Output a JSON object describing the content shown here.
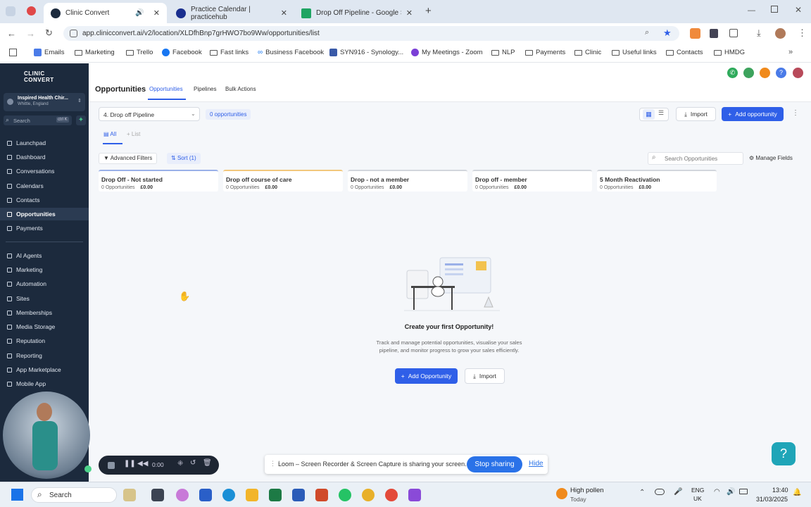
{
  "browser": {
    "tabs": [
      {
        "title": "Clinic Convert",
        "active": true
      },
      {
        "title": "Practice Calendar | practicehub",
        "active": false
      },
      {
        "title": "Drop Off Pipeline - Google She",
        "active": false
      }
    ],
    "new_tab": "+",
    "url": "app.clinicconvert.ai/v2/location/XLDfhBnp7grHWO7bo9Ww/opportunities/list",
    "bookmarks": [
      "Emails",
      "Marketing",
      "Trello",
      "Facebook",
      "Fast links",
      "Business Facebook",
      "SYN916 - Synology...",
      "My Meetings - Zoom",
      "NLP",
      "Payments",
      "Clinic",
      "Useful links",
      "Contacts",
      "HMDG"
    ]
  },
  "sidebar": {
    "logo": "CLINIC CONVERT",
    "account_name": "Inspired Health Chir...",
    "account_location": "Whittle, England",
    "search_placeholder": "Search",
    "search_shortcut": "ctrl K",
    "items": [
      "Launchpad",
      "Dashboard",
      "Conversations",
      "Calendars",
      "Contacts",
      "Opportunities",
      "Payments"
    ],
    "items2": [
      "AI Agents",
      "Marketing",
      "Automation",
      "Sites",
      "Memberships",
      "Media Storage",
      "Reputation",
      "Reporting",
      "App Marketplace",
      "Mobile App"
    ],
    "active": "Opportunities"
  },
  "header": {
    "title": "Opportunities",
    "tabs": [
      "Opportunities",
      "Pipelines",
      "Bulk Actions"
    ]
  },
  "toolbar": {
    "pipeline": "4. Drop off Pipeline",
    "count": "0 opportunities",
    "import": "Import",
    "add": "Add opportunity",
    "view_all": "All",
    "view_list": "List",
    "filters": "Advanced Filters",
    "sort": "Sort (1)",
    "search_placeholder": "Search Opportunities",
    "manage_fields": "Manage Fields"
  },
  "stages": [
    {
      "name": "Drop Off - Not started",
      "count": "0 Opportunities",
      "value": "£0.00"
    },
    {
      "name": "Drop off course of care",
      "count": "0 Opportunities",
      "value": "£0.00"
    },
    {
      "name": "Drop - not a member",
      "count": "0 Opportunities",
      "value": "£0.00"
    },
    {
      "name": "Drop off - member",
      "count": "0 Opportunities",
      "value": "£0.00"
    },
    {
      "name": "5 Month Reactivation",
      "count": "0 Opportunities",
      "value": "£0.00"
    }
  ],
  "empty": {
    "title": "Create your first Opportunity!",
    "text": "Track and manage potential opportunities, visualise your sales pipeline, and monitor progress to grow your sales efficiently.",
    "add": "Add Opportunity",
    "import": "Import"
  },
  "recorder": {
    "time": "0:00"
  },
  "loom": {
    "text": "Loom – Screen Recorder & Screen Capture is sharing your screen.",
    "stop": "Stop sharing",
    "hide": "Hide"
  },
  "taskbar": {
    "search": "Search",
    "weather": "High pollen",
    "weather_sub": "Today",
    "lang": "ENG",
    "region": "UK",
    "time": "13:40",
    "date": "31/03/2025"
  },
  "colors": {
    "accent": "#2f5fe8",
    "sidebar": "#1c2a3d"
  }
}
